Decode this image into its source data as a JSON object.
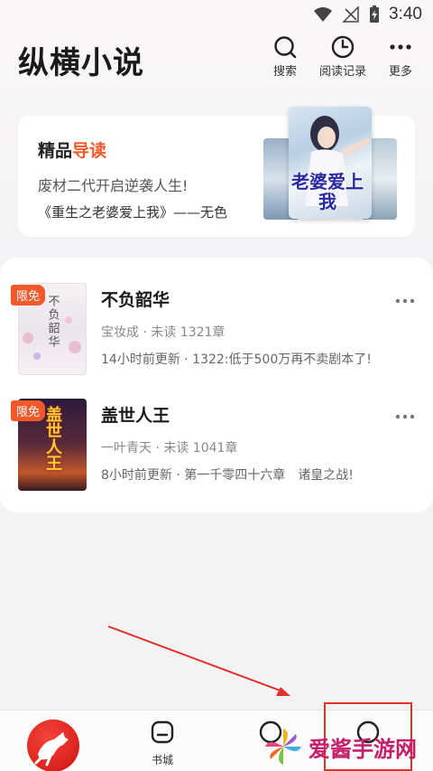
{
  "status": {
    "time": "3:40"
  },
  "header": {
    "title": "纵横小说",
    "search_label": "搜索",
    "history_label": "阅读记录",
    "more_label": "更多"
  },
  "feature": {
    "title_plain": "精品",
    "title_highlight": "导读",
    "line1": "废材二代开启逆袭人生!",
    "line2": "《重生之老婆爱上我》——无色",
    "cover_text": "老婆爱上我"
  },
  "books": [
    {
      "title": "不负韶华",
      "badge": "限免",
      "meta": "宝妆成 · 未读 1321章",
      "update": "14小时前更新 · 1322:低于500万再不卖剧本了!",
      "cover_text": "不负韶华"
    },
    {
      "title": "盖世人王",
      "badge": "限免",
      "meta": "一叶青天 · 未读 1041章",
      "update": "8小时前更新 · 第一千零四十六章　诸皇之战!",
      "cover_text": "盖世人王"
    }
  ],
  "nav": {
    "store_label": "书城"
  },
  "watermark": {
    "text": "爱酱手游网"
  },
  "colors": {
    "accent": "#f2592a",
    "highlight": "#e0322b",
    "brand_red": "#d9221c"
  }
}
